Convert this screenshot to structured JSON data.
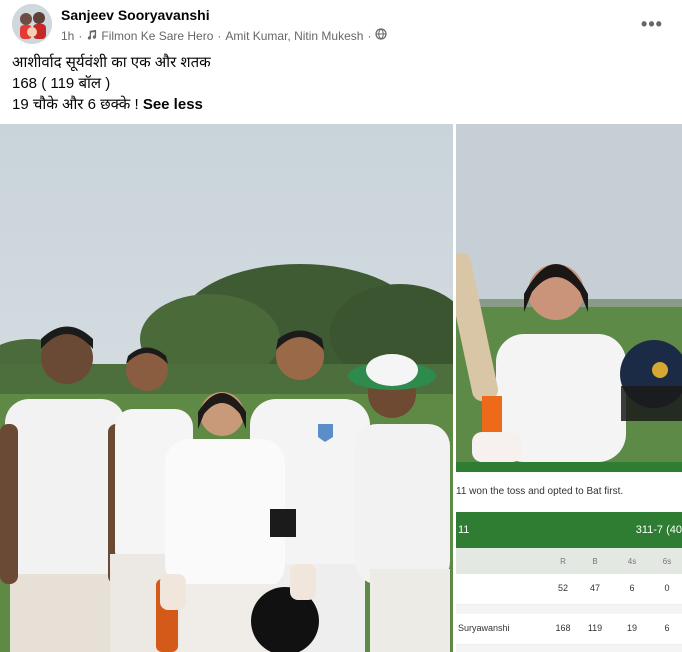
{
  "post": {
    "author": "Sanjeev Sooryavanshi",
    "time": "1h",
    "music": "Filmon Ke Sare Hero",
    "artists": "Amit Kumar, Nitin Mukesh",
    "separator": "·",
    "more_label": "•••",
    "text_lines": [
      "आशीर्वाद सूर्यवंशी का एक और शतक",
      "168 ( 119 बॉल )",
      "19 चौके और 6 छक्के !"
    ],
    "see_less": "See less"
  },
  "scorecard": {
    "toss": "11 won the toss and opted to Bat first.",
    "team": "11",
    "score": "311-7 (40",
    "headers": {
      "r": "R",
      "b": "B",
      "fours": "4s",
      "sixes": "6s"
    },
    "rows": [
      {
        "name": "",
        "r": "52",
        "b": "47",
        "fours": "6",
        "sixes": "0"
      },
      {
        "name": "Suryawanshi",
        "r": "168",
        "b": "119",
        "fours": "19",
        "sixes": "6"
      }
    ]
  },
  "colors": {
    "scorecard_green": "#2e7d32",
    "text_primary": "#050505",
    "text_secondary": "#65676b"
  },
  "icons": {
    "music": "music-note-icon",
    "audience": "globe-icon",
    "more": "more-options-icon"
  }
}
